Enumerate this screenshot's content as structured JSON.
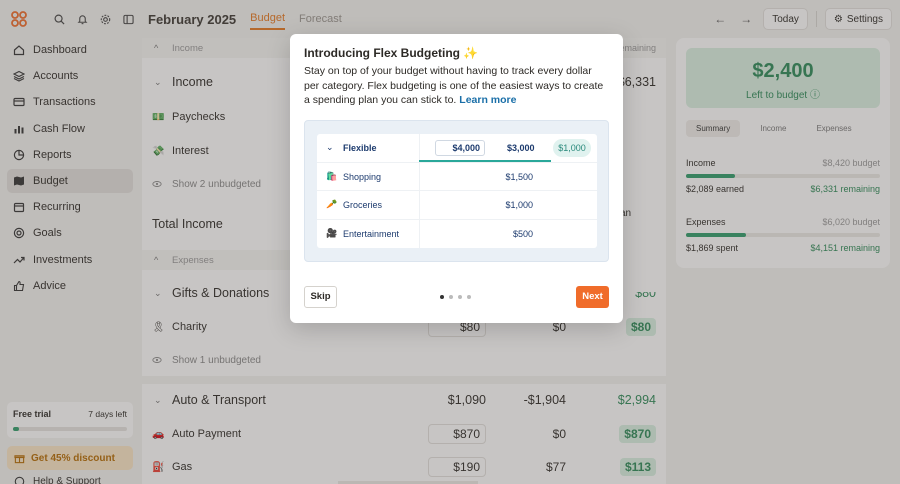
{
  "sidebar": {
    "items": [
      {
        "label": "Dashboard",
        "icon": "home-icon"
      },
      {
        "label": "Accounts",
        "icon": "layers-icon"
      },
      {
        "label": "Transactions",
        "icon": "card-icon"
      },
      {
        "label": "Cash Flow",
        "icon": "barchart-icon"
      },
      {
        "label": "Reports",
        "icon": "pie-icon"
      },
      {
        "label": "Budget",
        "icon": "map-icon"
      },
      {
        "label": "Recurring",
        "icon": "calendar-icon"
      },
      {
        "label": "Goals",
        "icon": "target-icon"
      },
      {
        "label": "Investments",
        "icon": "trend-icon"
      },
      {
        "label": "Advice",
        "icon": "thumb-icon"
      }
    ],
    "trial": {
      "title": "Free trial",
      "days": "7 days left",
      "progress": 0.05
    },
    "discount": "Get 45% discount",
    "help": "Help & Support"
  },
  "header": {
    "month": "February 2025",
    "tabs": [
      "Budget",
      "Forecast"
    ],
    "today": "Today",
    "settings": "Settings"
  },
  "budget": {
    "income_header": "Income",
    "remaining_header": "Remaining",
    "income_group": "Income",
    "income_remaining": "$6,331",
    "paychecks": "Paychecks",
    "interest": "Interest",
    "show_unbudgeted_2": "Show 2 unbudgeted",
    "total_income": "Total Income",
    "expenses_header": "Expenses",
    "gifts_group": "Gifts & Donations",
    "gifts_remaining": "$80",
    "charity": "Charity",
    "charity_budget": "$80",
    "charity_actual": "$0",
    "charity_remaining": "$80",
    "show_unbudgeted_1": "Show 1 unbudgeted",
    "auto_group": "Auto & Transport",
    "auto_budget": "$1,090",
    "auto_actual": "-$1,904",
    "auto_remaining": "$2,994",
    "auto_payment": "Auto Payment",
    "auto_payment_budget": "$870",
    "auto_payment_actual": "$0",
    "auto_payment_remaining": "$870",
    "gas": "Gas",
    "gas_budget": "$190",
    "gas_actual": "$77",
    "gas_remaining": "$113",
    "partial_text": "an"
  },
  "summary": {
    "amount": "$2,400",
    "label": "Left to budget",
    "tabs": [
      "Summary",
      "Income",
      "Expenses"
    ],
    "income_label": "Income",
    "income_budget": "$8,420 budget",
    "income_earned": "$2,089 earned",
    "income_remaining": "$6,331 remaining",
    "income_progress": 0.25,
    "expenses_label": "Expenses",
    "expenses_budget": "$6,020 budget",
    "expenses_spent": "$1,869 spent",
    "expenses_remaining": "$4,151 remaining",
    "expenses_progress": 0.31
  },
  "modal": {
    "title": "Introducing Flex Budgeting ✨",
    "description": "Stay on top of your budget without having to track every dollar per category. Flex budgeting is one of the easiest ways to create a spending plan you can stick to.",
    "link": "Learn more",
    "preview": {
      "flexible_label": "Flexible",
      "flex_values": [
        "$4,000",
        "$3,000",
        "$1,000"
      ],
      "rows": [
        {
          "label": "Shopping",
          "icon": "🛍️",
          "value": "$1,500"
        },
        {
          "label": "Groceries",
          "icon": "🥕",
          "value": "$1,000"
        },
        {
          "label": "Entertainment",
          "icon": "🎥",
          "value": "$500"
        }
      ]
    },
    "skip": "Skip",
    "next": "Next",
    "pages": 4,
    "active_page": 0
  },
  "colors": {
    "accent": "#e5781f",
    "green": "#2c8a57",
    "next_button": "#f06c2a",
    "teal": "#2aa89a"
  }
}
